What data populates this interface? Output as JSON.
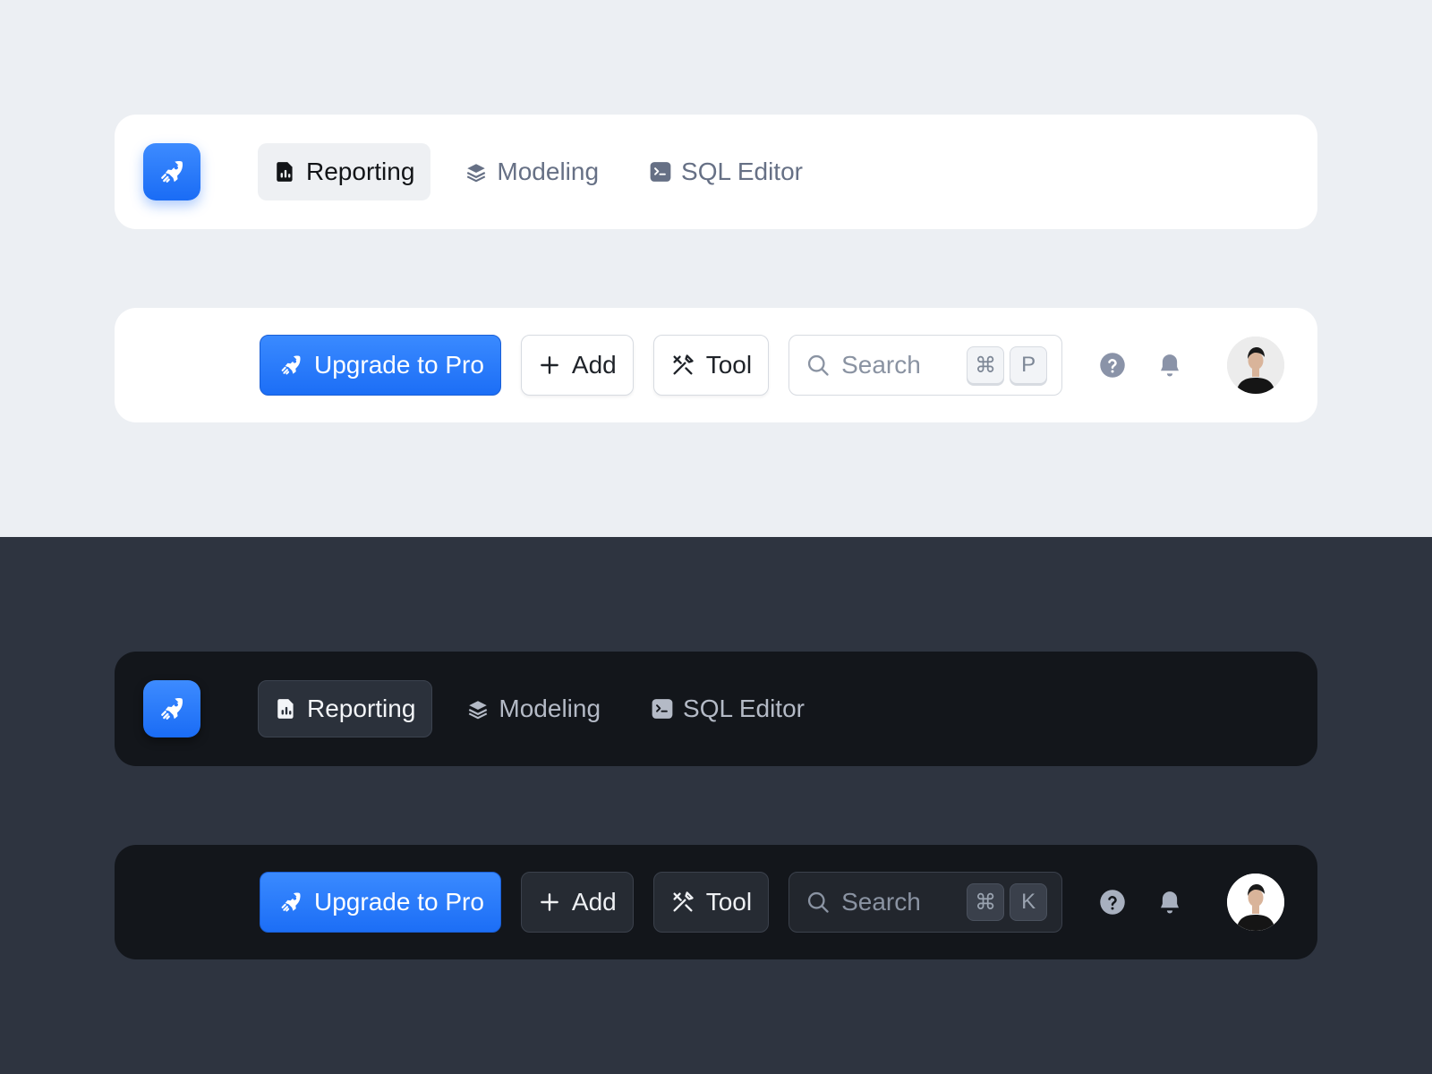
{
  "light": {
    "nav": {
      "tabs": [
        {
          "label": "Reporting",
          "icon": "report-chart-icon",
          "active": true
        },
        {
          "label": "Modeling",
          "icon": "layers-icon",
          "active": false
        },
        {
          "label": "SQL Editor",
          "icon": "terminal-icon",
          "active": false
        }
      ]
    },
    "actions": {
      "upgrade_label": "Upgrade to Pro",
      "add_label": "Add",
      "tool_label": "Tool",
      "search_placeholder": "Search",
      "shortcut_mod": "⌘",
      "shortcut_key": "P"
    }
  },
  "dark": {
    "nav": {
      "tabs": [
        {
          "label": "Reporting",
          "icon": "report-chart-icon",
          "active": true
        },
        {
          "label": "Modeling",
          "icon": "layers-icon",
          "active": false
        },
        {
          "label": "SQL Editor",
          "icon": "terminal-icon",
          "active": false
        }
      ]
    },
    "actions": {
      "upgrade_label": "Upgrade to Pro",
      "add_label": "Add",
      "tool_label": "Tool",
      "search_placeholder": "Search",
      "shortcut_mod": "⌘",
      "shortcut_key": "K"
    }
  },
  "colors": {
    "primary": "#1c6ef6",
    "light_bg": "#eceff3",
    "dark_bg": "#2e3440",
    "dark_panel": "#13161b",
    "icon_gray": "#8a93a8"
  }
}
